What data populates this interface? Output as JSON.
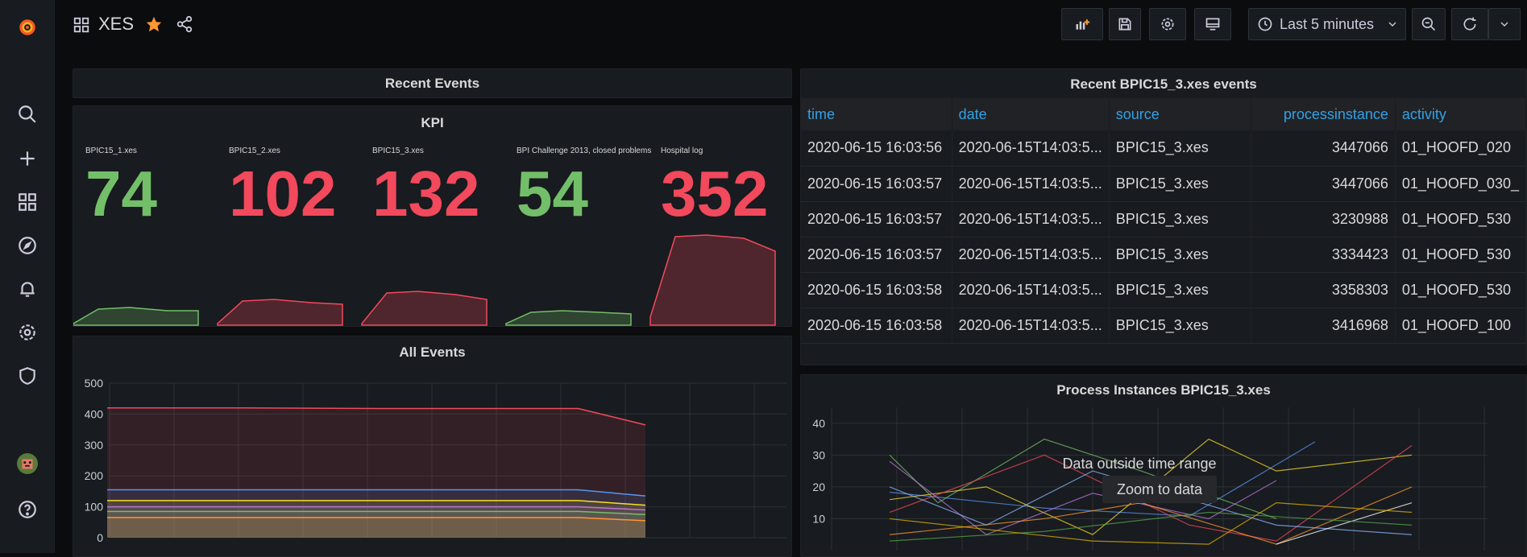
{
  "header": {
    "title": "XES",
    "time_range": "Last 5 minutes"
  },
  "sidebar": {
    "items": [
      "grafana-logo-icon",
      "search-icon",
      "plus-icon",
      "dashboards-icon",
      "explore-icon",
      "alerting-icon",
      "configuration-icon",
      "shield-icon",
      "user-avatar",
      "help-icon"
    ]
  },
  "panels": {
    "recent_events": {
      "title": "Recent Events"
    },
    "kpi": {
      "title": "KPI",
      "stats": [
        {
          "label": "BPIC15_1.xes",
          "value": "74",
          "color": "#73bf69"
        },
        {
          "label": "BPIC15_2.xes",
          "value": "102",
          "color": "#f2495c"
        },
        {
          "label": "BPIC15_3.xes",
          "value": "132",
          "color": "#f2495c"
        },
        {
          "label": "BPI Challenge 2013, closed problems",
          "value": "54",
          "color": "#73bf69"
        },
        {
          "label": "Hospital log",
          "value": "352",
          "color": "#f2495c"
        }
      ]
    },
    "table": {
      "title": "Recent BPIC15_3.xes events",
      "columns": [
        "time",
        "date",
        "source",
        "processinstance",
        "activity"
      ],
      "rows": [
        [
          "2020-06-15 16:03:56",
          "2020-06-15T14:03:5...",
          "BPIC15_3.xes",
          "3447066",
          "01_HOOFD_020"
        ],
        [
          "2020-06-15 16:03:57",
          "2020-06-15T14:03:5...",
          "BPIC15_3.xes",
          "3447066",
          "01_HOOFD_030_"
        ],
        [
          "2020-06-15 16:03:57",
          "2020-06-15T14:03:5...",
          "BPIC15_3.xes",
          "3230988",
          "01_HOOFD_530"
        ],
        [
          "2020-06-15 16:03:57",
          "2020-06-15T14:03:5...",
          "BPIC15_3.xes",
          "3334423",
          "01_HOOFD_530"
        ],
        [
          "2020-06-15 16:03:58",
          "2020-06-15T14:03:5...",
          "BPIC15_3.xes",
          "3358303",
          "01_HOOFD_530"
        ],
        [
          "2020-06-15 16:03:58",
          "2020-06-15T14:03:5...",
          "BPIC15_3.xes",
          "3416968",
          "01_HOOFD_100"
        ]
      ]
    },
    "all_events": {
      "title": "All Events"
    },
    "process_instances": {
      "title": "Process Instances BPIC15_3.xes",
      "overlay_text": "Data outside time range",
      "zoom_button": "Zoom to data"
    }
  },
  "chart_data": [
    {
      "type": "area",
      "title": "All Events",
      "ylim": [
        0,
        500
      ],
      "yticks": [
        0,
        100,
        200,
        300,
        400,
        500
      ],
      "x": [
        0,
        1,
        2,
        3,
        4,
        5,
        6,
        7,
        8
      ],
      "series": [
        {
          "values": [
            420,
            420,
            420,
            419,
            418,
            418,
            418,
            418,
            365
          ],
          "color": "#f2495c"
        },
        {
          "values": [
            155,
            155,
            155,
            155,
            155,
            155,
            155,
            155,
            135
          ],
          "color": "#5794f2"
        },
        {
          "values": [
            120,
            120,
            120,
            120,
            120,
            120,
            120,
            120,
            105
          ],
          "color": "#fade2a"
        },
        {
          "values": [
            100,
            100,
            100,
            100,
            100,
            100,
            100,
            100,
            90
          ],
          "color": "#b877d9"
        },
        {
          "values": [
            85,
            85,
            85,
            85,
            85,
            85,
            85,
            85,
            75
          ],
          "color": "#73bf69"
        },
        {
          "values": [
            65,
            65,
            65,
            65,
            65,
            65,
            65,
            65,
            55
          ],
          "color": "#ff9830"
        }
      ]
    },
    {
      "type": "line",
      "title": "Process Instances BPIC15_3.xes",
      "ylim": [
        0,
        45
      ],
      "yticks": [
        10,
        20,
        30,
        40
      ]
    }
  ]
}
